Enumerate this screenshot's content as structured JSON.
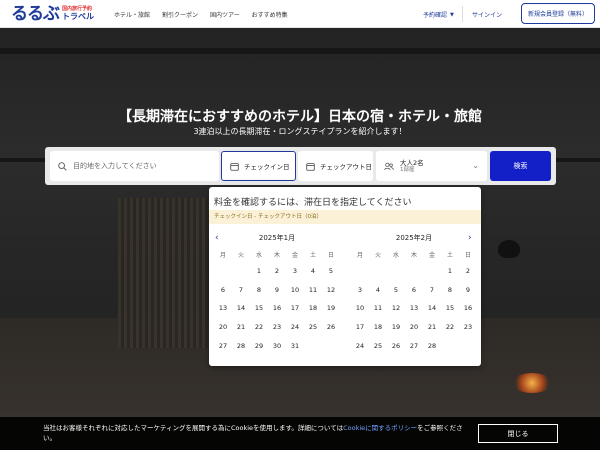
{
  "header": {
    "logo_main": "るるぶ",
    "logo_sub1": "国内旅行予約",
    "logo_sub2": "トラベル",
    "nav": [
      "ホテル・旅館",
      "割引クーポン",
      "国内ツアー",
      "おすすめ特集"
    ],
    "reserve_label": "予約確認",
    "signin_label": "サインイン",
    "register_label": "新規会員登録（無料）"
  },
  "hero": {
    "title": "【長期滞在におすすめのホテル】日本の宿・ホテル・旅館",
    "subtitle": "3連泊以上の長期滞在・ロングステイプランを紹介します！"
  },
  "search": {
    "destination_placeholder": "目的地を入力してください",
    "checkin_label": "チェックイン日",
    "checkout_label": "チェックアウト日",
    "guests_main": "大人2名",
    "guests_sub": "1部屋",
    "search_button": "検索"
  },
  "calendar": {
    "title": "料金を確認するには、滞在日を指定してください",
    "strip": "チェックイン日 - チェックアウト日（0泊）",
    "weekdays": [
      "月",
      "火",
      "水",
      "木",
      "金",
      "土",
      "日"
    ],
    "months": [
      {
        "title": "2025年1月",
        "weeks": [
          [
            "",
            "",
            "1",
            "2",
            "3",
            "4",
            "5"
          ],
          [
            "6",
            "7",
            "8",
            "9",
            "10",
            "11",
            "12"
          ],
          [
            "13",
            "14",
            "15",
            "16",
            "17",
            "18",
            "19"
          ],
          [
            "20",
            "21",
            "22",
            "23",
            "24",
            "25",
            "26"
          ],
          [
            "27",
            "28",
            "29",
            "30",
            "31",
            "",
            ""
          ]
        ]
      },
      {
        "title": "2025年2月",
        "weeks": [
          [
            "",
            "",
            "",
            "",
            "",
            "1",
            "2"
          ],
          [
            "3",
            "4",
            "5",
            "6",
            "7",
            "8",
            "9"
          ],
          [
            "10",
            "11",
            "12",
            "13",
            "14",
            "15",
            "16"
          ],
          [
            "17",
            "18",
            "19",
            "20",
            "21",
            "22",
            "23"
          ],
          [
            "24",
            "25",
            "26",
            "27",
            "28",
            "",
            ""
          ]
        ]
      }
    ]
  },
  "cookie": {
    "text_1": "当社はお客様それぞれに対応したマーケティングを展開する為にCookieを使用します。詳細については",
    "link": "Cookieに関するポリシー",
    "text_2": "をご参照ください。",
    "close_label": "閉じる"
  }
}
